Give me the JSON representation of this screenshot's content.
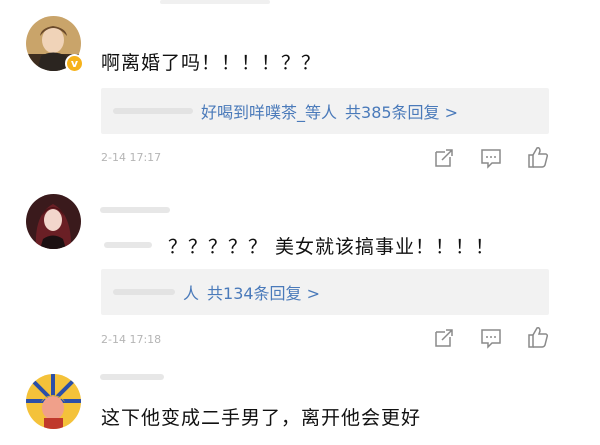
{
  "comments": [
    {
      "text": "啊离婚了吗！！！！？？",
      "reply_names": "好喝到咩噗茶_等人",
      "reply_count": "共385条回复 >",
      "timestamp": "2-14 17:17",
      "verified": true
    },
    {
      "text": "？？？？？ 美女就该搞事业！！！！",
      "reply_names": "人",
      "reply_count": "共134条回复 >",
      "timestamp": "2-14 17:18",
      "verified": false
    },
    {
      "text": "这下他变成二手男了，离开他会更好",
      "verified": false
    }
  ],
  "icons": {
    "share": "share-icon",
    "reply": "comment-icon",
    "like": "thumbs-up-icon"
  },
  "colors": {
    "link_blue": "#4a7aba",
    "reply_bg": "#f2f2f2",
    "timestamp_grey": "#b5b5b5",
    "verified_gold": "#f6b21a"
  }
}
